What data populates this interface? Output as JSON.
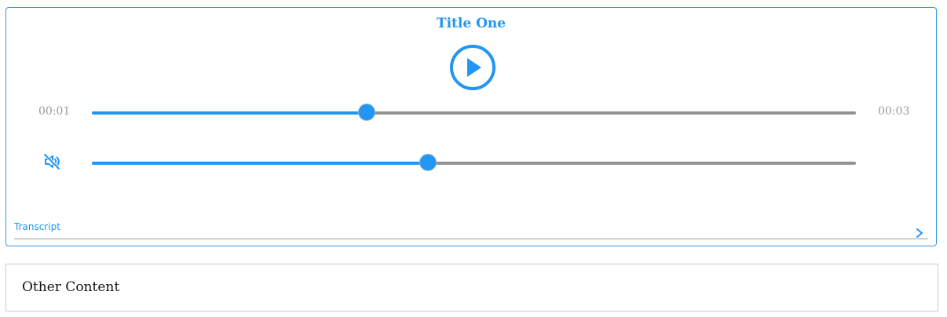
{
  "player": {
    "title": "Title One",
    "play_icon": "play-circle-icon",
    "current_time": "00:01",
    "total_time": "00:03",
    "progress_fraction": 0.36,
    "volume_fraction": 0.44,
    "mute_icon": "volume-off-icon",
    "transcript_label": "Transcript",
    "transcript_icon": "chevron-right-icon"
  },
  "other": {
    "text": "Other Content"
  },
  "colors": {
    "accent": "#2196f3",
    "track": "#939393",
    "time_text": "#999999",
    "border": "#2f9ad8"
  }
}
